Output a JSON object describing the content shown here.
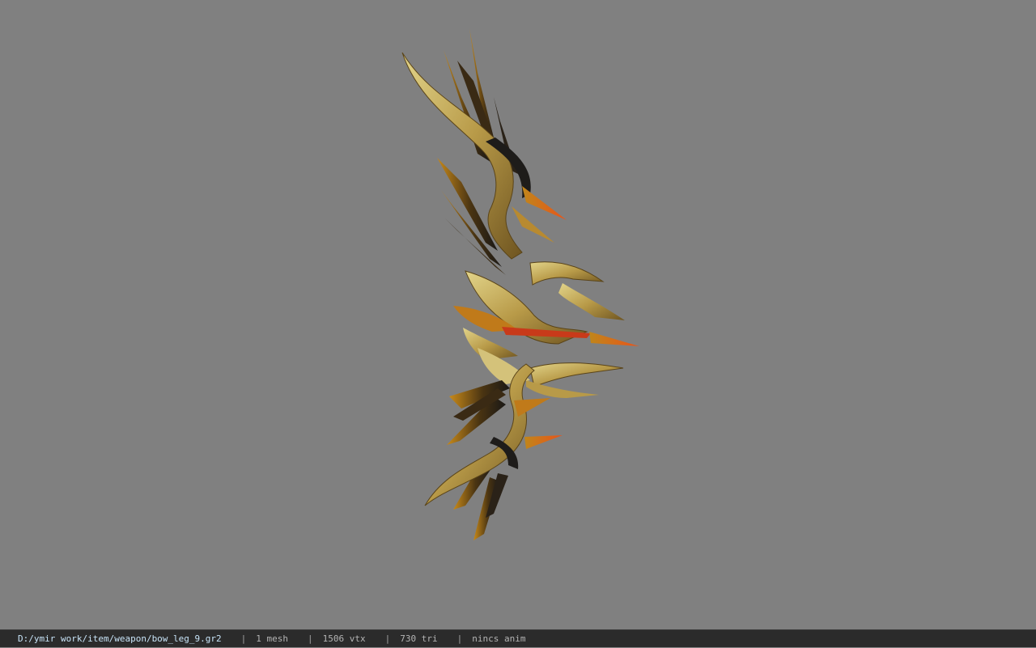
{
  "viewer": {
    "background_color": "#808080",
    "model": {
      "description_icon": "bow-model-icon",
      "palette": {
        "gold_light": "#d8c878",
        "gold": "#b89a48",
        "gold_dark": "#7a6024",
        "black": "#1e1c1a",
        "orange": "#e06a1a",
        "red_tip": "#c83a1a"
      }
    }
  },
  "status_bar": {
    "file_path": "D:/ymir work/item/weapon/bow_leg_9.gr2",
    "separator": "|",
    "mesh_count": "1 mesh",
    "vertex_count": "1506 vtx",
    "triangle_count": "730 tri",
    "animation": "nincs anim"
  }
}
